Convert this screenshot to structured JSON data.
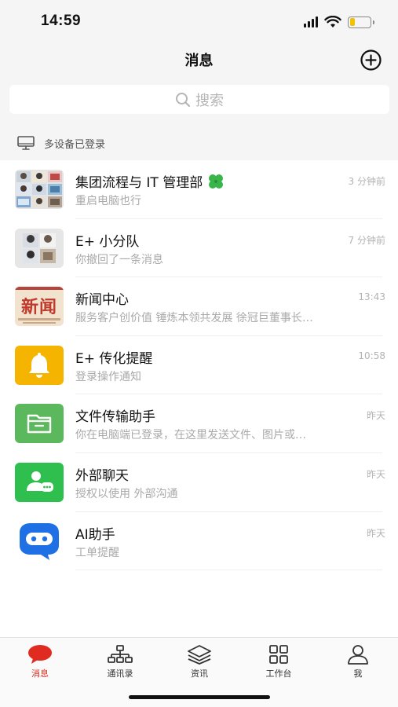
{
  "status_bar": {
    "time": "14:59",
    "battery_level": 0.25
  },
  "nav": {
    "title": "消息"
  },
  "search": {
    "placeholder": "搜索"
  },
  "device_notice": {
    "text": "多设备已登录"
  },
  "conversations": [
    {
      "title": "集团流程与 IT 管理部",
      "subtitle": "重启电脑也行",
      "time": "3 分钟前"
    },
    {
      "title": "E+ 小分队",
      "subtitle": "你撤回了一条消息",
      "time": "7 分钟前"
    },
    {
      "title": "新闻中心",
      "subtitle": "服务客户创价值 锤炼本领共发展 徐冠巨董事长…",
      "time": "13:43",
      "avatar_text": "新闻"
    },
    {
      "title": "E+ 传化提醒",
      "subtitle": "登录操作通知",
      "time": "10:58"
    },
    {
      "title": "文件传输助手",
      "subtitle": "你在电脑端已登录，在这里发送文件、图片或…",
      "time": "昨天"
    },
    {
      "title": "外部聊天",
      "subtitle": "授权以使用 外部沟通",
      "time": "昨天"
    },
    {
      "title": "AI助手",
      "subtitle": "工单提醒",
      "time": "昨天"
    }
  ],
  "tabs": [
    {
      "label": "消息",
      "icon": "chat-bubble-icon",
      "active": true
    },
    {
      "label": "通讯录",
      "icon": "org-chart-icon",
      "active": false
    },
    {
      "label": "资讯",
      "icon": "layers-icon",
      "active": false
    },
    {
      "label": "工作台",
      "icon": "grid-icon",
      "active": false
    },
    {
      "label": "我",
      "icon": "person-icon",
      "active": false
    }
  ],
  "colors": {
    "accent_red": "#e02b20",
    "bell_yellow": "#f4b400",
    "file_green": "#5cb85c",
    "chat_green": "#2fbf4f",
    "ai_blue": "#1f6fe5"
  }
}
